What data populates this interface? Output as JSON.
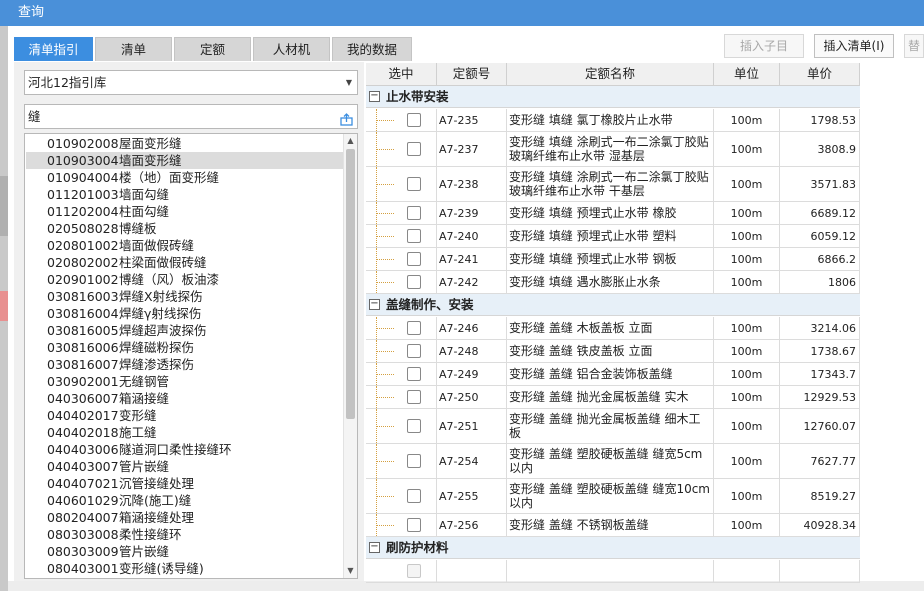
{
  "window": {
    "title": "查询"
  },
  "tabs": [
    "清单指引",
    "清单",
    "定额",
    "人材机",
    "我的数据"
  ],
  "toolbar": {
    "insert_child": "插入子目",
    "insert_list": "插入清单(I)",
    "replace": "替"
  },
  "library": {
    "selected": "河北12指引库"
  },
  "search": {
    "value": "缝"
  },
  "list": [
    {
      "code": "010902008",
      "name": "屋面变形缝"
    },
    {
      "code": "010903004",
      "name": "墙面变形缝"
    },
    {
      "code": "010904004",
      "name": "楼（地）面变形缝"
    },
    {
      "code": "011201003",
      "name": "墙面勾缝"
    },
    {
      "code": "011202004",
      "name": "柱面勾缝"
    },
    {
      "code": "020508028",
      "name": "博缝板"
    },
    {
      "code": "020801002",
      "name": "墙面做假砖缝"
    },
    {
      "code": "020802002",
      "name": "柱梁面做假砖缝"
    },
    {
      "code": "020901002",
      "name": "博缝（风）板油漆"
    },
    {
      "code": "030816003",
      "name": "焊缝X射线探伤"
    },
    {
      "code": "030816004",
      "name": "焊缝γ射线探伤"
    },
    {
      "code": "030816005",
      "name": "焊缝超声波探伤"
    },
    {
      "code": "030816006",
      "name": "焊缝磁粉探伤"
    },
    {
      "code": "030816007",
      "name": "焊缝渗透探伤"
    },
    {
      "code": "030902001",
      "name": "无缝钢管"
    },
    {
      "code": "040306007",
      "name": "箱涵接缝"
    },
    {
      "code": "040402017",
      "name": "变形缝"
    },
    {
      "code": "040402018",
      "name": "施工缝"
    },
    {
      "code": "040403006",
      "name": "隧道洞口柔性接缝环"
    },
    {
      "code": "040403007",
      "name": "管片嵌缝"
    },
    {
      "code": "040407021",
      "name": "沉管接缝处理"
    },
    {
      "code": "040601029",
      "name": "沉降(施工)缝"
    },
    {
      "code": "080204007",
      "name": "箱涵接缝处理"
    },
    {
      "code": "080303008",
      "name": "柔性接缝环"
    },
    {
      "code": "080303009",
      "name": "管片嵌缝"
    },
    {
      "code": "080403001",
      "name": "变形缝(诱导缝)"
    }
  ],
  "grid": {
    "headers": {
      "select": "选中",
      "code": "定额号",
      "name": "定额名称",
      "unit": "单位",
      "price": "单价"
    },
    "groups": [
      {
        "label": "止水带安装",
        "rows": [
          {
            "code": "A7-235",
            "name": "变形缝 填缝 氯丁橡胶片止水带",
            "unit": "100m",
            "price": "1798.53"
          },
          {
            "code": "A7-237",
            "name": "变形缝 填缝 涂刷式一布二涂氯丁胶贴玻璃纤维布止水带 湿基层",
            "unit": "100m",
            "price": "3808.9"
          },
          {
            "code": "A7-238",
            "name": "变形缝 填缝 涂刷式一布二涂氯丁胶贴玻璃纤维布止水带 干基层",
            "unit": "100m",
            "price": "3571.83"
          },
          {
            "code": "A7-239",
            "name": "变形缝 填缝 预埋式止水带 橡胶",
            "unit": "100m",
            "price": "6689.12"
          },
          {
            "code": "A7-240",
            "name": "变形缝 填缝 预埋式止水带 塑料",
            "unit": "100m",
            "price": "6059.12"
          },
          {
            "code": "A7-241",
            "name": "变形缝 填缝 预埋式止水带 钢板",
            "unit": "100m",
            "price": "6866.2"
          },
          {
            "code": "A7-242",
            "name": "变形缝 填缝 遇水膨胀止水条",
            "unit": "100m",
            "price": "1806"
          }
        ]
      },
      {
        "label": "盖缝制作、安装",
        "rows": [
          {
            "code": "A7-246",
            "name": "变形缝 盖缝 木板盖板 立面",
            "unit": "100m",
            "price": "3214.06"
          },
          {
            "code": "A7-248",
            "name": "变形缝 盖缝 铁皮盖板 立面",
            "unit": "100m",
            "price": "1738.67"
          },
          {
            "code": "A7-249",
            "name": "变形缝 盖缝 铝合金装饰板盖缝",
            "unit": "100m",
            "price": "17343.7"
          },
          {
            "code": "A7-250",
            "name": "变形缝 盖缝 抛光金属板盖缝 实木",
            "unit": "100m",
            "price": "12929.53"
          },
          {
            "code": "A7-251",
            "name": "变形缝 盖缝 抛光金属板盖缝 细木工板",
            "unit": "100m",
            "price": "12760.07"
          },
          {
            "code": "A7-254",
            "name": "变形缝 盖缝 塑胶硬板盖缝 缝宽5cm以内",
            "unit": "100m",
            "price": "7627.77"
          },
          {
            "code": "A7-255",
            "name": "变形缝 盖缝 塑胶硬板盖缝 缝宽10cm以内",
            "unit": "100m",
            "price": "8519.27"
          },
          {
            "code": "A7-256",
            "name": "变形缝 盖缝 不锈钢板盖缝",
            "unit": "100m",
            "price": "40928.34"
          }
        ]
      },
      {
        "label": "刷防护材料",
        "rows": [
          {
            "code": "",
            "name": "",
            "unit": "",
            "price": ""
          }
        ]
      }
    ]
  },
  "colors": {
    "title_bar": "#4a90d9",
    "active_tab": "#3c8ee0",
    "group_row": "#e7f0f8"
  }
}
